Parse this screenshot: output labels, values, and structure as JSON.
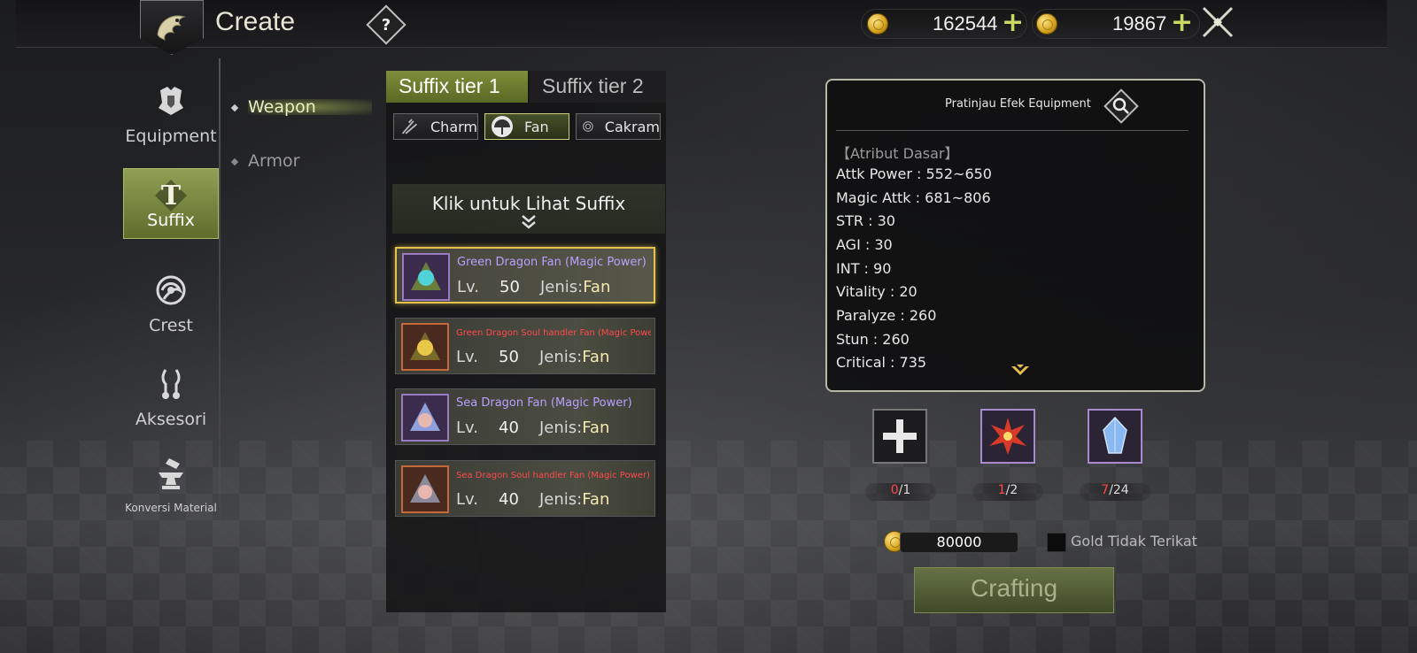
{
  "header": {
    "title": "Create",
    "help_label": "?",
    "currency1": "162544",
    "currency2": "19867"
  },
  "nav": {
    "items": [
      {
        "label": "Equipment"
      },
      {
        "label": "Suffix"
      },
      {
        "label": "Crest"
      },
      {
        "label": "Aksesori"
      },
      {
        "label": "Konversi Material"
      }
    ],
    "sub_items": [
      {
        "label": "Weapon"
      },
      {
        "label": "Armor"
      }
    ]
  },
  "middle": {
    "tabs": [
      "Suffix tier 1",
      "Suffix tier 2"
    ],
    "types": [
      "Charm",
      "Fan",
      "Cakram"
    ],
    "prompt": "Klik untuk Lihat Suffix",
    "items": [
      {
        "name": "Green Dragon Fan (Magic Power)",
        "lv_label": "Lv.",
        "lv": "50",
        "jenis_label": "Jenis:",
        "jenis": "Fan"
      },
      {
        "name": "Green Dragon Soul handler Fan (Magic Power)",
        "lv_label": "Lv.",
        "lv": "50",
        "jenis_label": "Jenis:",
        "jenis": "Fan"
      },
      {
        "name": "Sea Dragon Fan (Magic Power)",
        "lv_label": "Lv.",
        "lv": "40",
        "jenis_label": "Jenis:",
        "jenis": "Fan"
      },
      {
        "name": "Sea Dragon Soul handler Fan (Magic Power)",
        "lv_label": "Lv.",
        "lv": "40",
        "jenis_label": "Jenis:",
        "jenis": "Fan"
      }
    ]
  },
  "preview": {
    "title": "Pratinjau Efek Equipment",
    "section": "【Atribut Dasar】",
    "attrs": [
      "Attk Power : 552~650",
      "Magic Attk : 681~806",
      "STR : 30",
      "AGI : 30",
      "INT : 90",
      "Vitality : 20",
      "Paralyze : 260",
      "Stun : 260",
      "Critical : 735"
    ]
  },
  "materials": [
    {
      "have": "0",
      "need": "/1"
    },
    {
      "have": "1",
      "need": "/2"
    },
    {
      "have": "7",
      "need": "/24"
    }
  ],
  "cost": {
    "gold": "80000",
    "checkbox_label": "Gold Tidak Terikat",
    "craft_label": "Crafting"
  }
}
